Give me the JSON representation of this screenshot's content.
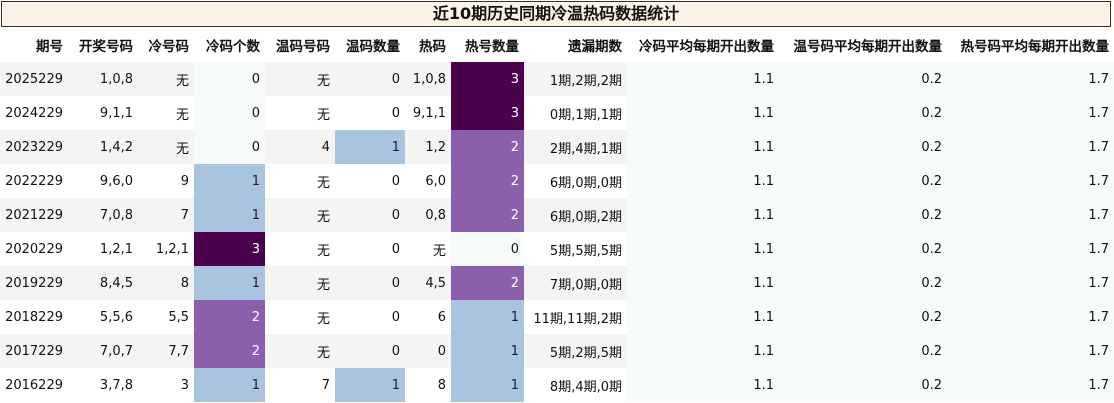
{
  "title": "近10期历史同期冷温热码数据统计",
  "columns": [
    "期号",
    "开奖号码",
    "冷号码",
    "冷码个数",
    "温码号码",
    "温码数量",
    "热码",
    "热号数量",
    "遗漏期数",
    "冷码平均每期开出数量",
    "温号码平均每期开出数量",
    "热号码平均每期开出数量"
  ],
  "level_colors": {
    "1": "#a9c4de",
    "2": "#8b5fac",
    "3": "#4b004b"
  },
  "rows": [
    {
      "issue": "2025229",
      "draw": "1,0,8",
      "cold": "无",
      "cold_count": "0",
      "warm": "无",
      "warm_count": "0",
      "hot": "1,0,8",
      "hot_count": "3",
      "miss": "1期,2期,2期",
      "cold_avg": "1.1",
      "warm_avg": "0.2",
      "hot_avg": "1.7"
    },
    {
      "issue": "2024229",
      "draw": "9,1,1",
      "cold": "无",
      "cold_count": "0",
      "warm": "无",
      "warm_count": "0",
      "hot": "9,1,1",
      "hot_count": "3",
      "miss": "0期,1期,1期",
      "cold_avg": "1.1",
      "warm_avg": "0.2",
      "hot_avg": "1.7"
    },
    {
      "issue": "2023229",
      "draw": "1,4,2",
      "cold": "无",
      "cold_count": "0",
      "warm": "4",
      "warm_count": "1",
      "hot": "1,2",
      "hot_count": "2",
      "miss": "2期,4期,1期",
      "cold_avg": "1.1",
      "warm_avg": "0.2",
      "hot_avg": "1.7"
    },
    {
      "issue": "2022229",
      "draw": "9,6,0",
      "cold": "9",
      "cold_count": "1",
      "warm": "无",
      "warm_count": "0",
      "hot": "6,0",
      "hot_count": "2",
      "miss": "6期,0期,0期",
      "cold_avg": "1.1",
      "warm_avg": "0.2",
      "hot_avg": "1.7"
    },
    {
      "issue": "2021229",
      "draw": "7,0,8",
      "cold": "7",
      "cold_count": "1",
      "warm": "无",
      "warm_count": "0",
      "hot": "0,8",
      "hot_count": "2",
      "miss": "6期,0期,2期",
      "cold_avg": "1.1",
      "warm_avg": "0.2",
      "hot_avg": "1.7"
    },
    {
      "issue": "2020229",
      "draw": "1,2,1",
      "cold": "1,2,1",
      "cold_count": "3",
      "warm": "无",
      "warm_count": "0",
      "hot": "无",
      "hot_count": "0",
      "miss": "5期,5期,5期",
      "cold_avg": "1.1",
      "warm_avg": "0.2",
      "hot_avg": "1.7"
    },
    {
      "issue": "2019229",
      "draw": "8,4,5",
      "cold": "8",
      "cold_count": "1",
      "warm": "无",
      "warm_count": "0",
      "hot": "4,5",
      "hot_count": "2",
      "miss": "7期,0期,0期",
      "cold_avg": "1.1",
      "warm_avg": "0.2",
      "hot_avg": "1.7"
    },
    {
      "issue": "2018229",
      "draw": "5,5,6",
      "cold": "5,5",
      "cold_count": "2",
      "warm": "无",
      "warm_count": "0",
      "hot": "6",
      "hot_count": "1",
      "miss": "11期,11期,2期",
      "cold_avg": "1.1",
      "warm_avg": "0.2",
      "hot_avg": "1.7"
    },
    {
      "issue": "2017229",
      "draw": "7,0,7",
      "cold": "7,7",
      "cold_count": "2",
      "warm": "无",
      "warm_count": "0",
      "hot": "0",
      "hot_count": "1",
      "miss": "5期,2期,5期",
      "cold_avg": "1.1",
      "warm_avg": "0.2",
      "hot_avg": "1.7"
    },
    {
      "issue": "2016229",
      "draw": "3,7,8",
      "cold": "3",
      "cold_count": "1",
      "warm": "7",
      "warm_count": "1",
      "hot": "8",
      "hot_count": "1",
      "miss": "8期,4期,0期",
      "cold_avg": "1.1",
      "warm_avg": "0.2",
      "hot_avg": "1.7"
    }
  ]
}
